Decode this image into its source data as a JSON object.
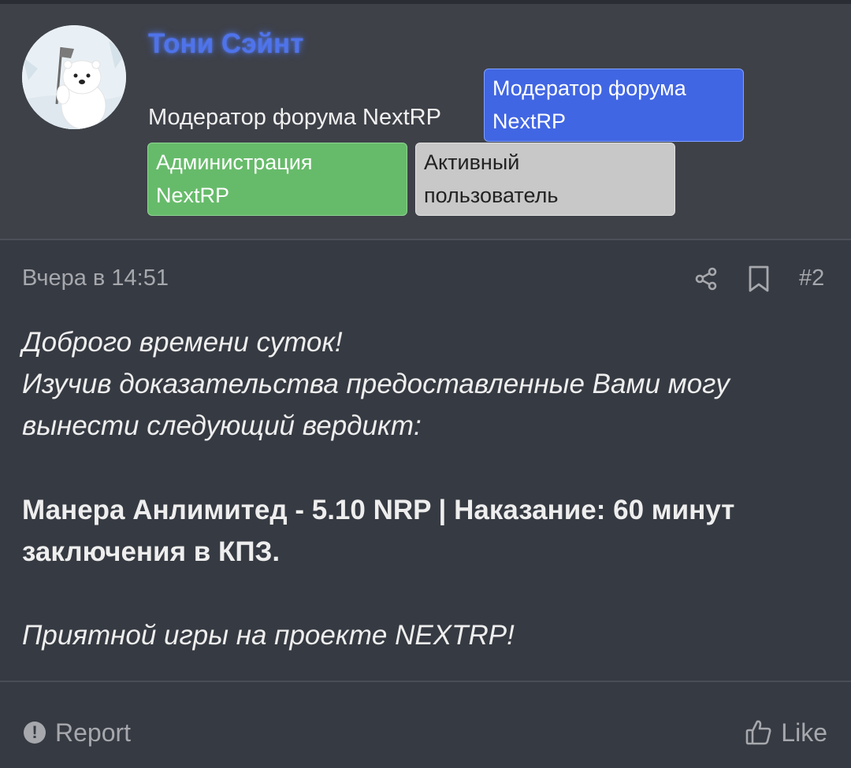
{
  "author": {
    "name": "Тони Сэйнт",
    "title": "Модератор форума NextRP",
    "badges": [
      {
        "line1": "Модератор форума",
        "line2": "NextRP"
      },
      {
        "line1": "Администрация",
        "line2": "NextRP"
      },
      {
        "line1": "Активный",
        "line2": "пользователь"
      }
    ]
  },
  "post": {
    "date": "Вчера в 14:51",
    "number": "#2",
    "lines": {
      "greeting": "Доброго времени суток!",
      "intro_1": "Изучив доказательства предоставленные Вами могу",
      "intro_2": "вынести следующий вердикт:",
      "verdict_1": "Манера Анлимитед - 5.10 NRP | Наказание: 60 минут",
      "verdict_2": "заключения в КПЗ.",
      "closing": "Приятной игры на проекте NEXTRP!"
    }
  },
  "footer": {
    "report_label": "Report",
    "like_label": "Like"
  },
  "icons": {
    "share": "share-icon",
    "bookmark": "bookmark-icon",
    "report": "alert-circle-icon",
    "like": "thumbs-up-icon"
  },
  "colors": {
    "username": "#4f73ea",
    "badge_moderator": "#4166e3",
    "badge_admin": "#66bb6a",
    "badge_active": "#c8c8c8"
  }
}
